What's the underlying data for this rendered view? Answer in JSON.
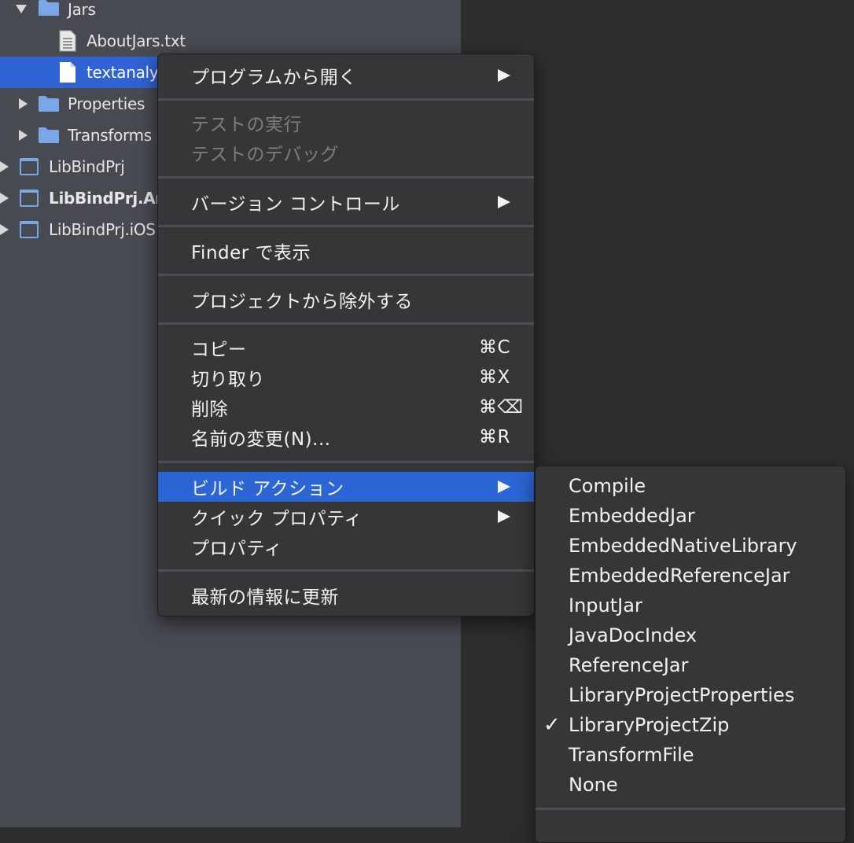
{
  "tree": {
    "items": [
      {
        "label": "Jars",
        "disclosure": "expanded",
        "icon": "folder-icon"
      },
      {
        "label": "AboutJars.txt",
        "icon": "text-file-icon"
      },
      {
        "label": "textanaly",
        "icon": "file-icon",
        "selected": true
      },
      {
        "label": "Properties",
        "disclosure": "collapsed",
        "icon": "folder-icon"
      },
      {
        "label": "Transforms",
        "disclosure": "collapsed",
        "icon": "folder-icon"
      },
      {
        "label": "LibBindPrj",
        "disclosure": "collapsed",
        "icon": "project-icon"
      },
      {
        "label": "LibBindPrj.Ar",
        "disclosure": "collapsed",
        "icon": "project-icon",
        "bold": true
      },
      {
        "label": "LibBindPrj.iOS",
        "disclosure": "collapsed",
        "icon": "project-icon"
      }
    ]
  },
  "context_menu": {
    "items": [
      {
        "label": "プログラムから開く",
        "submenu": true
      },
      {
        "label": "テストの実行",
        "disabled": true
      },
      {
        "label": "テストのデバッグ",
        "disabled": true
      },
      {
        "label": "バージョン コントロール",
        "submenu": true
      },
      {
        "label": "Finder で表示"
      },
      {
        "label": "プロジェクトから除外する"
      },
      {
        "label": "コピー",
        "shortcut": "⌘C"
      },
      {
        "label": "切り取り",
        "shortcut": "⌘X"
      },
      {
        "label": "削除",
        "shortcut": "⌘⌫"
      },
      {
        "label": "名前の変更(N)...",
        "shortcut": "⌘R"
      },
      {
        "label": "ビルド アクション",
        "submenu": true,
        "active": true
      },
      {
        "label": "クイック プロパティ",
        "submenu": true
      },
      {
        "label": "プロパティ"
      },
      {
        "label": "最新の情報に更新"
      }
    ]
  },
  "build_action_submenu": {
    "items": [
      {
        "label": "Compile"
      },
      {
        "label": "EmbeddedJar"
      },
      {
        "label": "EmbeddedNativeLibrary"
      },
      {
        "label": "EmbeddedReferenceJar"
      },
      {
        "label": "InputJar"
      },
      {
        "label": "JavaDocIndex"
      },
      {
        "label": "ReferenceJar"
      },
      {
        "label": "LibraryProjectProperties"
      },
      {
        "label": "LibraryProjectZip",
        "checked": true
      },
      {
        "label": "TransformFile"
      },
      {
        "label": "None"
      }
    ],
    "check_mark": "✓"
  },
  "colors": {
    "sidebar_bg": "#474a51",
    "selection": "#2f62d2",
    "menu_bg": "#353638",
    "folder": "#7aa7e8"
  }
}
